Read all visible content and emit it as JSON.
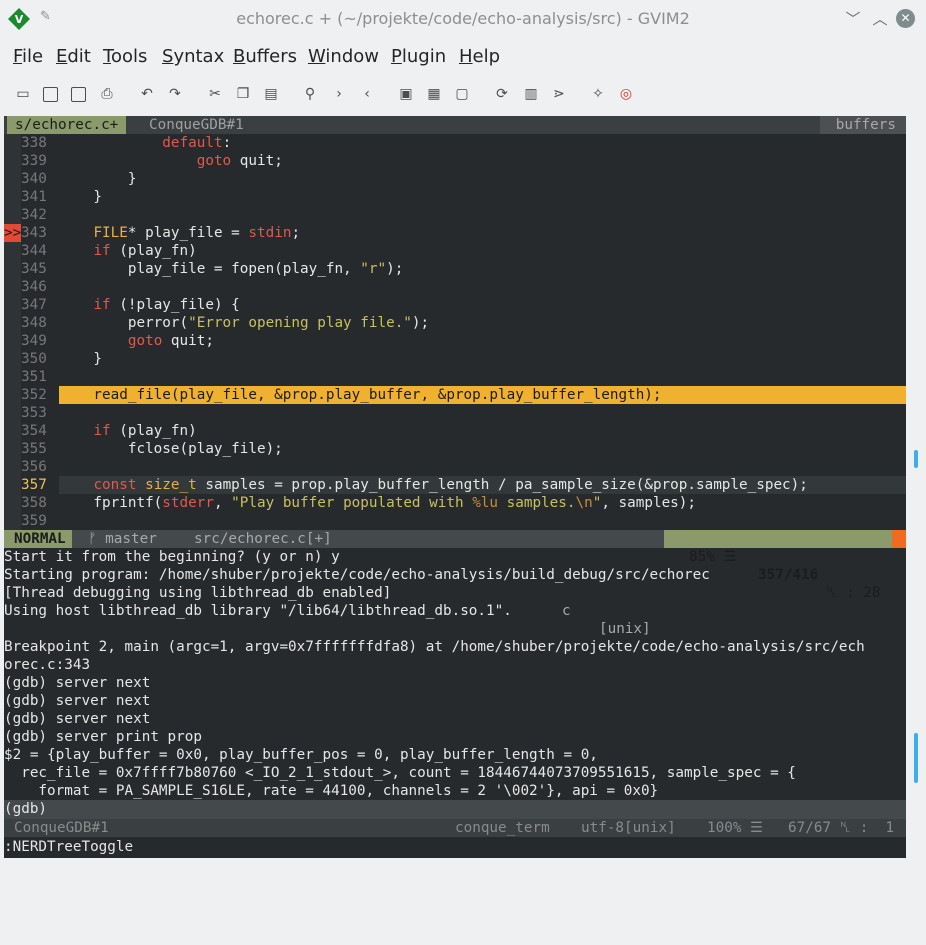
{
  "window": {
    "title": "echorec.c + (~/projekte/code/echo-analysis/src) - GVIM2",
    "app_icon": "vim-icon"
  },
  "menu": [
    "File",
    "Edit",
    "Tools",
    "Syntax",
    "Buffers",
    "Window",
    "Plugin",
    "Help"
  ],
  "toolbar": [
    "open-icon",
    "save-icon",
    "save-all-icon",
    "print-icon",
    "undo-icon",
    "redo-icon",
    "cut-icon",
    "copy-icon",
    "paste-icon",
    "find-icon",
    "find-next-icon",
    "find-prev-icon",
    "load-session-icon",
    "save-session-icon",
    "run-script-icon",
    "make-icon",
    "shell-icon",
    "tags-icon",
    "tag-jump-icon",
    "help-icon"
  ],
  "tabline": {
    "active": "s/echorec.c+",
    "inactive": "ConqueGDB#1",
    "right": "buffers"
  },
  "code_lines": [
    {
      "n": "338",
      "sign": "",
      "tokens": [
        {
          "t": "            "
        },
        {
          "t": "default",
          "c": "kw"
        },
        {
          "t": ":"
        }
      ]
    },
    {
      "n": "339",
      "sign": "",
      "tokens": [
        {
          "t": "                "
        },
        {
          "t": "goto",
          "c": "kw"
        },
        {
          "t": " quit;"
        }
      ]
    },
    {
      "n": "340",
      "sign": "",
      "tokens": [
        {
          "t": "        }"
        }
      ]
    },
    {
      "n": "341",
      "sign": "",
      "tokens": [
        {
          "t": "    }"
        }
      ]
    },
    {
      "n": "342",
      "sign": "",
      "tokens": []
    },
    {
      "n": "343",
      "sign": ">>",
      "tokens": [
        {
          "t": "    "
        },
        {
          "t": "FILE",
          "c": "ty"
        },
        {
          "t": "* play_file = "
        },
        {
          "t": "stdin",
          "c": "kw"
        },
        {
          "t": ";"
        }
      ]
    },
    {
      "n": "344",
      "sign": "",
      "tokens": [
        {
          "t": "    "
        },
        {
          "t": "if",
          "c": "kw"
        },
        {
          "t": " (play_fn)"
        }
      ]
    },
    {
      "n": "345",
      "sign": "",
      "tokens": [
        {
          "t": "        play_file = fopen(play_fn, "
        },
        {
          "t": "\"r\"",
          "c": "str"
        },
        {
          "t": ");"
        }
      ]
    },
    {
      "n": "346",
      "sign": "",
      "tokens": []
    },
    {
      "n": "347",
      "sign": "",
      "tokens": [
        {
          "t": "    "
        },
        {
          "t": "if",
          "c": "kw"
        },
        {
          "t": " (!play_file) {"
        }
      ]
    },
    {
      "n": "348",
      "sign": "",
      "tokens": [
        {
          "t": "        perror("
        },
        {
          "t": "\"Error opening play file.\"",
          "c": "str"
        },
        {
          "t": ");"
        }
      ]
    },
    {
      "n": "349",
      "sign": "",
      "tokens": [
        {
          "t": "        "
        },
        {
          "t": "goto",
          "c": "kw"
        },
        {
          "t": " quit;"
        }
      ]
    },
    {
      "n": "350",
      "sign": "",
      "tokens": [
        {
          "t": "    }"
        }
      ]
    },
    {
      "n": "351",
      "sign": "",
      "tokens": []
    },
    {
      "n": "352",
      "sign": "",
      "hl": true,
      "tokens": [
        {
          "t": "    read_file(play_file, &prop.play_buffer, &prop.play_buffer_length);"
        }
      ]
    },
    {
      "n": "353",
      "sign": "",
      "tokens": []
    },
    {
      "n": "354",
      "sign": "",
      "tokens": [
        {
          "t": "    "
        },
        {
          "t": "if",
          "c": "kw"
        },
        {
          "t": " (play_fn)"
        }
      ]
    },
    {
      "n": "355",
      "sign": "",
      "tokens": [
        {
          "t": "        fclose(play_file);"
        }
      ]
    },
    {
      "n": "356",
      "sign": "",
      "tokens": []
    },
    {
      "n": "357",
      "sign": "",
      "cur": true,
      "tokens": [
        {
          "t": "    "
        },
        {
          "t": "const",
          "c": "kw"
        },
        {
          "t": " "
        },
        {
          "t": "size_t",
          "c": "ty"
        },
        {
          "t": " samples = prop.play_buffer_length / pa_sample_size(&prop.sample_spec);"
        }
      ]
    },
    {
      "n": "358",
      "sign": "",
      "tokens": [
        {
          "t": "    fprintf("
        },
        {
          "t": "stderr",
          "c": "kw"
        },
        {
          "t": ", "
        },
        {
          "t": "\"Play buffer populated with ",
          "c": "str"
        },
        {
          "t": "%lu",
          "c": "esc"
        },
        {
          "t": " samples.",
          "c": "str"
        },
        {
          "t": "\\n",
          "c": "esc"
        },
        {
          "t": "\"",
          "c": "str"
        },
        {
          "t": ", samples);"
        }
      ]
    },
    {
      "n": "359",
      "sign": "",
      "tokens": []
    }
  ],
  "statusline": {
    "mode": "NORMAL",
    "branch": "ᚠ master",
    "file": "src/echorec.c[+]",
    "filetype": "c",
    "format": "[unix]",
    "percent": "85% ☰",
    "linecount": "357/416",
    "col": "␤ : 28"
  },
  "terminal_lines": [
    "Start it from the beginning? (y or n) y",
    "Starting program: /home/shuber/projekte/code/echo-analysis/build_debug/src/echorec",
    "[Thread debugging using libthread_db enabled]",
    "Using host libthread_db library \"/lib64/libthread_db.so.1\".",
    "",
    "Breakpoint 2, main (argc=1, argv=0x7fffffffdfa8) at /home/shuber/projekte/code/echo-analysis/src/ech",
    "orec.c:343",
    "(gdb) server next",
    "(gdb) server next",
    "(gdb) server next",
    "(gdb) server print prop",
    "$2 = {play_buffer = 0x0, play_buffer_pos = 0, play_buffer_length = 0,",
    "  rec_file = 0x7ffff7b80760 <_IO_2_1_stdout_>, count = 18446744073709551615, sample_spec = {",
    "    format = PA_SAMPLE_S16LE, rate = 44100, channels = 2 '\\002'}, api = 0x0}"
  ],
  "gdb_prompt": "(gdb)",
  "statusline2": {
    "name": "ConqueGDB#1",
    "type": "conque_term",
    "encoding": "utf-8[unix]",
    "percent": "100% ☰",
    "lines": "67/67 ␤ :  1"
  },
  "cmdline": ":NERDTreeToggle"
}
